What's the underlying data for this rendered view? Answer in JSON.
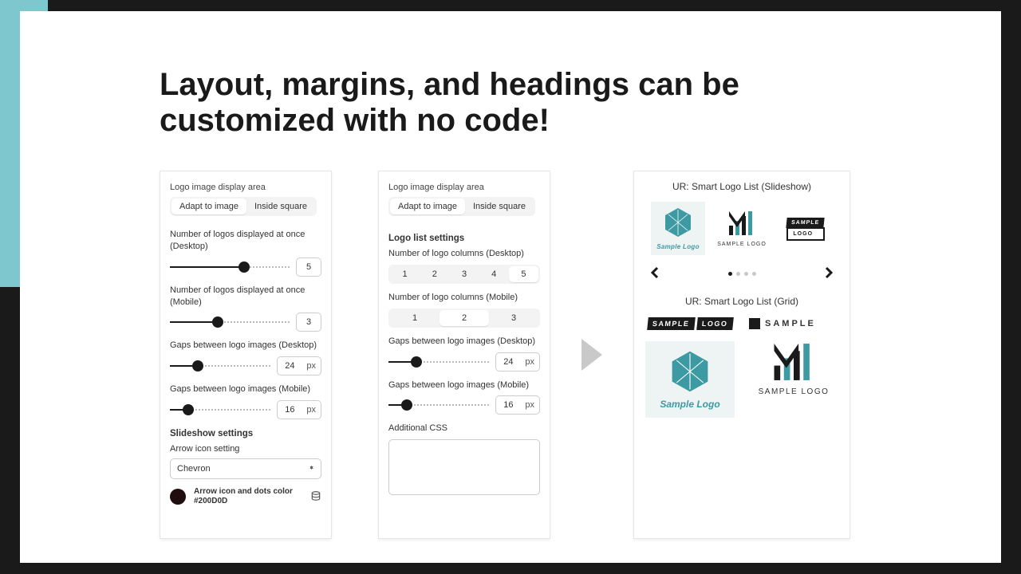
{
  "headline": "Layout, margins, and headings can be customized with no code!",
  "panel1": {
    "section_label": "Logo image display area",
    "seg_adapt": "Adapt to image",
    "seg_inside": "Inside square",
    "num_desktop_label": "Number of logos displayed at once (Desktop)",
    "num_desktop_value": "5",
    "num_mobile_label": "Number of logos displayed at once (Mobile)",
    "num_mobile_value": "3",
    "gap_desktop_label": "Gaps between logo images (Desktop)",
    "gap_desktop_value": "24",
    "gap_mobile_label": "Gaps between logo images (Mobile)",
    "gap_mobile_value": "16",
    "px": "px",
    "slideshow_heading": "Slideshow settings",
    "arrow_label": "Arrow icon setting",
    "arrow_value": "Chevron",
    "color_label": "Arrow icon and dots color",
    "color_hex": "#200D0D"
  },
  "panel2": {
    "section_label": "Logo image display area",
    "seg_adapt": "Adapt to image",
    "seg_inside": "Inside square",
    "list_heading": "Logo list settings",
    "cols_desktop_label": "Number of logo columns (Desktop)",
    "cols_desktop_opts": [
      "1",
      "2",
      "3",
      "4",
      "5"
    ],
    "cols_desktop_sel": "5",
    "cols_mobile_label": "Number of logo columns (Mobile)",
    "cols_mobile_opts": [
      "1",
      "2",
      "3"
    ],
    "cols_mobile_sel": "2",
    "gap_desktop_label": "Gaps between logo images (Desktop)",
    "gap_desktop_value": "24",
    "gap_mobile_label": "Gaps between logo images (Mobile)",
    "gap_mobile_value": "16",
    "px": "px",
    "css_label": "Additional CSS"
  },
  "preview": {
    "slideshow_title": "UR: Smart Logo List (Slideshow)",
    "grid_title": "UR: Smart Logo List (Grid)",
    "logo1_name": "Sample Logo",
    "logo2_name": "SAMPLE LOGO",
    "logo3_top": "SAMPLE",
    "logo3_bottom": "LOGO",
    "grid_logo1_top": "SAMPLE",
    "grid_logo1_bottom": "LOGO",
    "grid_logo2": "SAMPLE",
    "grid_logo3": "Sample Logo",
    "grid_logo4": "SAMPLE LOGO"
  }
}
